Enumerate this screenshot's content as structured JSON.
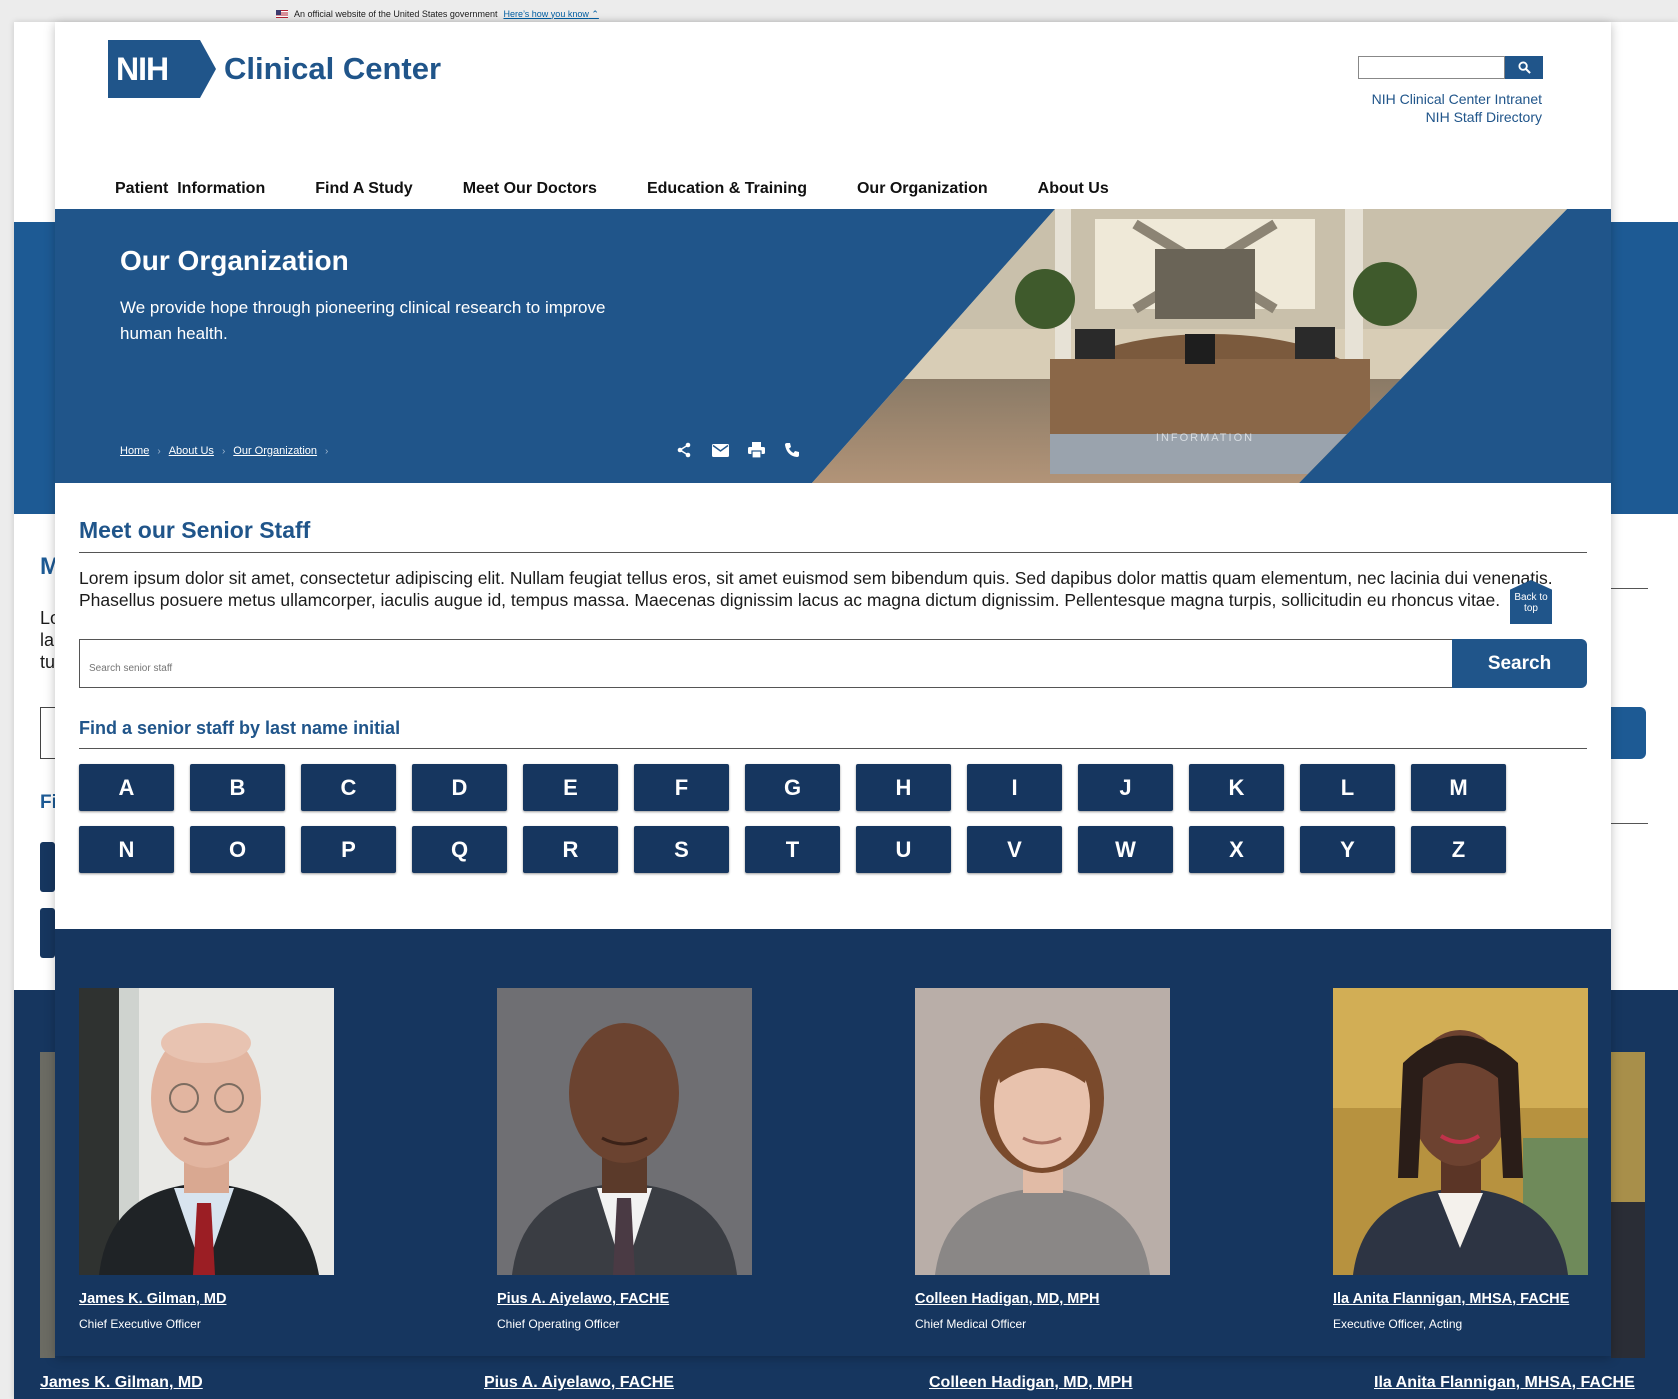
{
  "gov_banner": {
    "text": "An official website of the United States government",
    "link": "Here’s how you know"
  },
  "header": {
    "logo_mark": "NIH",
    "logo_text": "Clinical Center",
    "search_placeholder": "",
    "links": [
      "NIH Clinical Center Intranet",
      "NIH Staff Directory"
    ]
  },
  "nav": [
    "Patient  Information",
    "Find A Study",
    "Meet Our Doctors",
    "Education & Training",
    "Our Organization",
    "About Us"
  ],
  "hero": {
    "title": "Our Organization",
    "subtitle": "We provide hope through pioneering clinical research to improve human health.",
    "image_caption": "INFORMATION",
    "breadcrumb": [
      "Home",
      "About Us",
      "Our Organization"
    ]
  },
  "staff_section": {
    "heading": "Meet our Senior Staff",
    "intro": "Lorem ipsum dolor sit amet, consectetur adipiscing elit. Nullam feugiat tellus eros, sit amet euismod sem bibendum quis. Sed dapibus dolor mattis quam elementum, nec lacinia dui venenatis. Phasellus posuere metus ullamcorper, iaculis augue id, tempus massa. Maecenas dignissim lacus ac magna dictum dignissim. Pellentesque magna turpis, sollicitudin eu rhoncus vitae.",
    "search_placeholder": "Search senior staff",
    "search_button": "Search",
    "find_heading": "Find a senior staff by last name initial",
    "letters": [
      "A",
      "B",
      "C",
      "D",
      "E",
      "F",
      "G",
      "H",
      "I",
      "J",
      "K",
      "L",
      "M",
      "N",
      "O",
      "P",
      "Q",
      "R",
      "S",
      "T",
      "U",
      "V",
      "W",
      "X",
      "Y",
      "Z"
    ]
  },
  "back_to_top": "Back to top",
  "staff": [
    {
      "name": "James K. Gilman, MD",
      "title": "Chief Executive Officer"
    },
    {
      "name": "Pius A. Aiyelawo, FACHE",
      "title": "Chief Operating Officer"
    },
    {
      "name": "Colleen Hadigan, MD, MPH",
      "title": "Chief Medical Officer"
    },
    {
      "name": "Ila Anita Flannigan, MHSA, FACHE",
      "title": "Executive Officer, Acting"
    }
  ],
  "background_page": {
    "staff_names": [
      "James K. Gilman, MD",
      "Pius A. Aiyelawo, FACHE",
      "Colleen Hadigan, MD, MPH",
      "Ila Anita Flannigan, MHSA, FACHE"
    ]
  },
  "colors": {
    "primary": "#20558a",
    "dark_navy": "#16365f",
    "link": "#005ea2"
  },
  "icons": [
    "search-icon",
    "share-icon",
    "email-icon",
    "print-icon",
    "phone-icon",
    "flag-icon"
  ]
}
